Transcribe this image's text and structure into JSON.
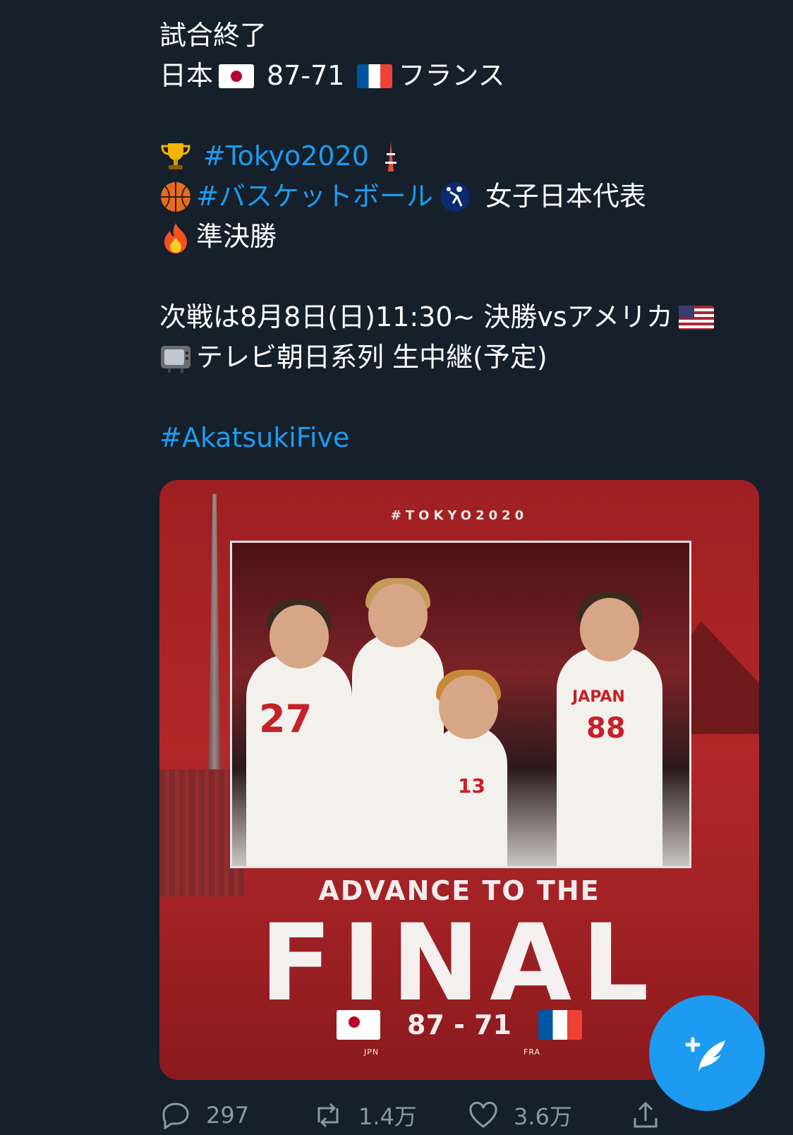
{
  "tweet": {
    "lines": {
      "l1": "試合終了",
      "l2_a": "日本",
      "l2_score": "87-71",
      "l2_b": "フランス",
      "l4_tag": "#Tokyo2020",
      "l5_tag": "#バスケットボール",
      "l5_text": "女子日本代表",
      "l6": "準決勝",
      "l8": "次戦は8月8日(日)11:30~ 決勝vsアメリカ",
      "l9": "テレビ朝日系列 生中継(予定)",
      "l11_tag": "#AkatsukiFive"
    }
  },
  "media": {
    "top_tag": "#TOKYO2020",
    "jersey_a": "JAPAN",
    "num_27": "27",
    "num_88": "88",
    "num_13": "13",
    "advance": "ADVANCE TO THE",
    "final": "FINAL",
    "score": "87 - 71",
    "team_left": "JPN",
    "team_right": "FRA"
  },
  "actions": {
    "replies": "297",
    "retweets": "1.4万",
    "likes": "3.6万"
  },
  "colors": {
    "background": "#15202b",
    "link": "#1d9bf0",
    "fab": "#1d9bf0",
    "muted": "#8899a6"
  }
}
